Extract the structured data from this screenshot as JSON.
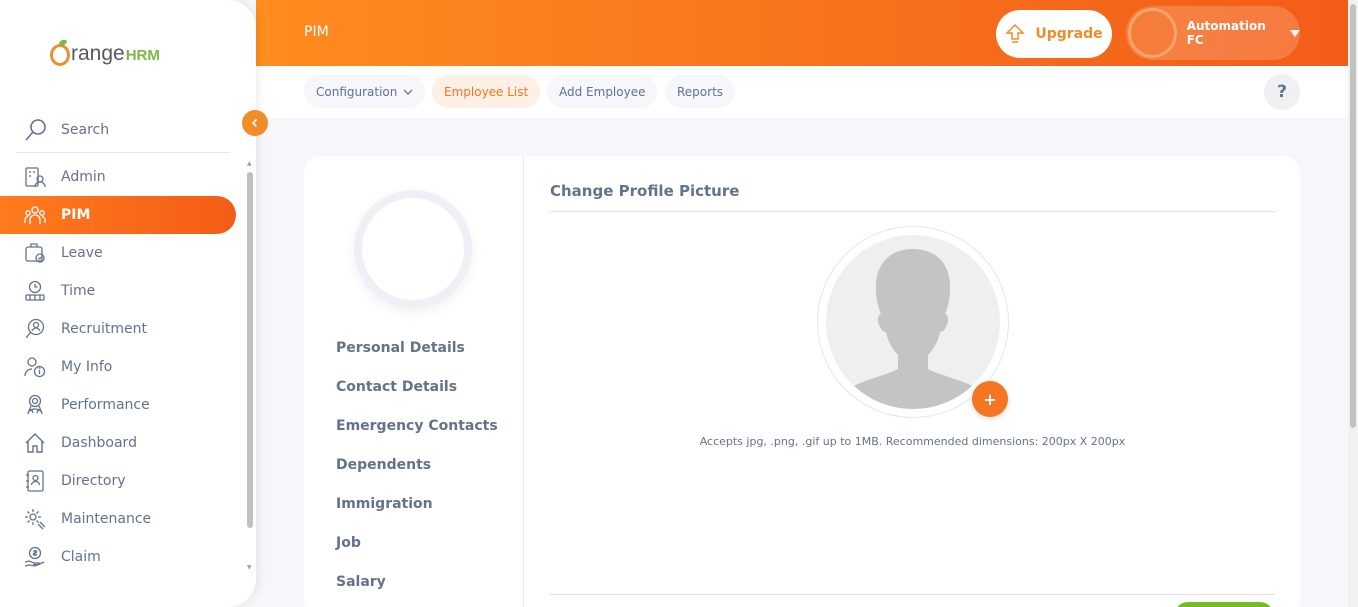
{
  "brand": {
    "logo_orange": "range",
    "logo_hrm": "HRM",
    "logo_text": "OrangeHRM"
  },
  "sidebar": {
    "search_label": "Search",
    "items": [
      {
        "label": "Admin",
        "icon": "admin-icon"
      },
      {
        "label": "PIM",
        "icon": "pim-icon",
        "active": true
      },
      {
        "label": "Leave",
        "icon": "leave-icon"
      },
      {
        "label": "Time",
        "icon": "time-icon"
      },
      {
        "label": "Recruitment",
        "icon": "recruitment-icon"
      },
      {
        "label": "My Info",
        "icon": "my-info-icon"
      },
      {
        "label": "Performance",
        "icon": "performance-icon"
      },
      {
        "label": "Dashboard",
        "icon": "dashboard-icon"
      },
      {
        "label": "Directory",
        "icon": "directory-icon"
      },
      {
        "label": "Maintenance",
        "icon": "maintenance-icon"
      },
      {
        "label": "Claim",
        "icon": "claim-icon"
      }
    ]
  },
  "header": {
    "title": "PIM",
    "upgrade_label": "Upgrade",
    "user_name": "Automation FC"
  },
  "subnav": {
    "tabs": [
      {
        "label": "Configuration",
        "dropdown": true
      },
      {
        "label": "Employee List",
        "active": true
      },
      {
        "label": "Add Employee"
      },
      {
        "label": "Reports"
      }
    ],
    "help_label": "?"
  },
  "employee_nav": {
    "items": [
      "Personal Details",
      "Contact Details",
      "Emergency Contacts",
      "Dependents",
      "Immigration",
      "Job",
      "Salary"
    ]
  },
  "profile_picture": {
    "title": "Change Profile Picture",
    "add_label": "+",
    "hint": "Accepts jpg, .png, .gif up to 1MB. Recommended dimensions: 200px X 200px"
  },
  "colors": {
    "accent": "#f47623",
    "header_start": "#ff8c1e",
    "header_end": "#f35c17",
    "text": "#64728c",
    "save_green": "#76bc21"
  }
}
